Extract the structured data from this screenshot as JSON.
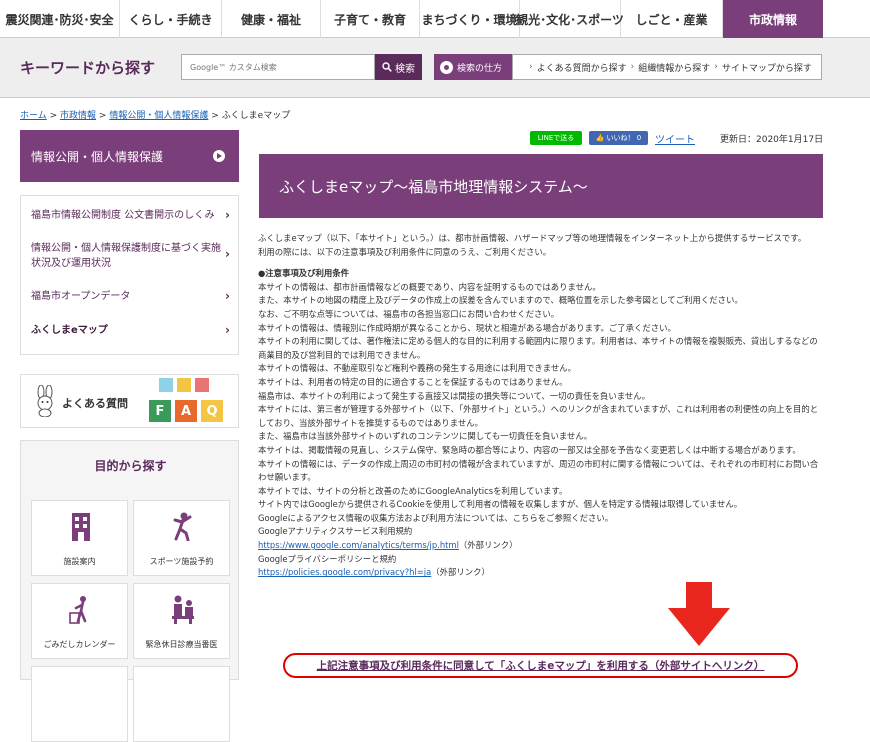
{
  "global_nav": {
    "items": [
      "震災関連･防災･安全",
      "くらし・手続き",
      "健康・福祉",
      "子育て・教育",
      "まちづくり・環境",
      "観光･文化･スポーツ",
      "しごと・産業",
      "市政情報"
    ]
  },
  "keyword": {
    "title": "キーワードから探す",
    "placeholder": "Google™ カスタム検索",
    "search_label": "検索",
    "howto_label": "検索の仕方",
    "links": [
      "よくある質問から探す",
      "組織情報から探す",
      "サイトマップから探す"
    ]
  },
  "breadcrumb": {
    "items": [
      "ホーム",
      "市政情報",
      "情報公開・個人情報保護"
    ],
    "current": "ふくしまeマップ",
    "sep": ">"
  },
  "sidebar": {
    "heading": "情報公開・個人情報保護",
    "items": [
      {
        "label": "福島市情報公開制度 公文書開示のしくみ"
      },
      {
        "label": "情報公開・個人情報保護制度に基づく実施状況及び運用状況"
      },
      {
        "label": "福島市オープンデータ"
      },
      {
        "label": "ふくしまeマップ"
      }
    ],
    "faq_label": "よくある質問",
    "faq_blocks": [
      "F",
      "A",
      "Q"
    ],
    "purpose_title": "目的から探す",
    "purpose_items": [
      {
        "label": "施設案内"
      },
      {
        "label": "スポーツ施設予約"
      },
      {
        "label": "ごみだしカレンダー"
      },
      {
        "label": "緊急休日診療当番医"
      }
    ]
  },
  "share": {
    "line_label": "LINEで送る",
    "like_label": "いいね！ 0",
    "tweet_label": "ツイート",
    "updated": "更新日：2020年1月17日"
  },
  "main": {
    "title": "ふくしまeマップ～福島市地理情報システム～",
    "intro": [
      "ふくしまeマップ（以下、「本サイト」という。）は、都市計画情報、ハザードマップ等の地理情報をインターネット上から提供するサービスです。",
      "利用の際には、以下の注意事項及び利用条件に同意のうえ、ご利用ください。"
    ],
    "notice_heading": "●注意事項及び利用条件",
    "notices": [
      "本サイトの情報は、都市計画情報などの概要であり、内容を証明するものではありません。",
      "また、本サイトの地図の精度上及びデータの作成上の誤差を含んでいますので、概略位置を示した参考図としてご利用ください。",
      "なお、ご不明な点等については、福島市の各担当窓口にお問い合わせください。",
      "本サイトの情報は、情報別に作成時期が異なることから、現状と相違がある場合があります。ご了承ください。",
      "本サイトの利用に関しては、著作権法に定める個人的な目的に利用する範囲内に限ります。利用者は、本サイトの情報を複製販売、貸出しするなどの商業目的及び営利目的では利用できません。",
      "本サイトの情報は、不動産取引など権利や義務の発生する用途には利用できません。",
      "本サイトは、利用者の特定の目的に適合することを保証するものではありません。",
      "福島市は、本サイトの利用によって発生する直接又は間接の損失等について、一切の責任を負いません。",
      "本サイトには、第三者が管理する外部サイト（以下、「外部サイト」という。）へのリンクが含まれていますが、これは利用者の利便性の向上を目的としており、当該外部サイトを推奨するものではありません。",
      "また、福島市は当該外部サイトのいずれのコンテンツに関しても一切責任を負いません。",
      "本サイトは、掲載情報の見直し、システム保守、緊急時の都合等により、内容の一部又は全部を予告なく変更若しくは中断する場合があります。",
      "本サイトの情報には、データの作成上周辺の市町村の情報が含まれていますが、周辺の市町村に関する情報については、それぞれの市町村にお問い合わせ願います。",
      "本サイトでは、サイトの分析と改善のためにGoogleAnalyticsを利用しています。",
      "サイト内ではGoogleから提供されるCookieを使用して利用者の情報を収集しますが、個人を特定する情報は取得していません。",
      "Googleによるアクセス情報の収集方法および利用方法については、こちらをご参照ください。",
      "Googleアナリティクスサービス利用規約"
    ],
    "ga_terms_url": "https://www.google.com/analytics/terms/jp.html",
    "external_note": "（外部リンク）",
    "privacy_title": "Googleプライバシーポリシーと規約",
    "privacy_url": "https://policies.google.com/privacy?hl=ja",
    "cta": "上記注意事項及び利用条件に同意して「ふくしまeマップ」を利用する（外部サイトへリンク）"
  },
  "colors": {
    "brand_purple": "#7a3e7a",
    "dark_purple": "#5a2a5a",
    "cta_red": "#e00000",
    "arrow_red": "#e8261e"
  }
}
